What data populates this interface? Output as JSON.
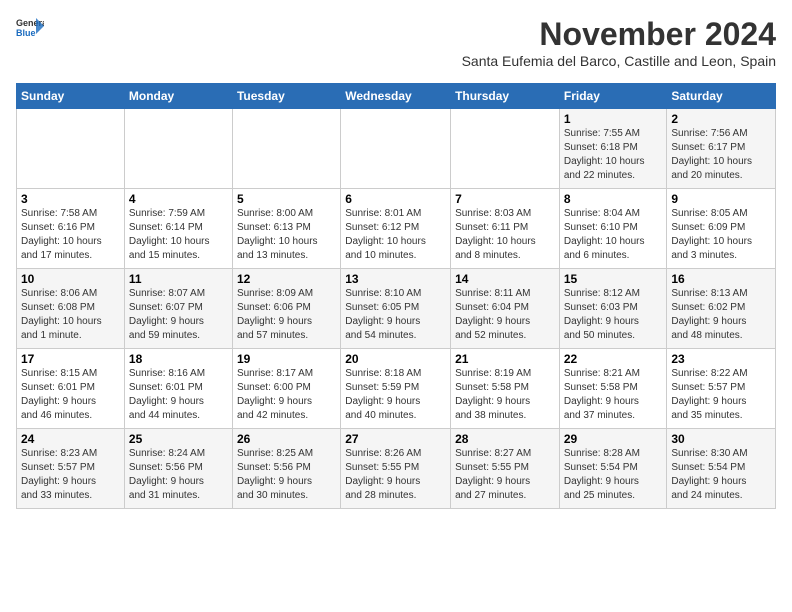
{
  "header": {
    "logo_line1": "General",
    "logo_line2": "Blue",
    "month_title": "November 2024",
    "subtitle": "Santa Eufemia del Barco, Castille and Leon, Spain"
  },
  "weekdays": [
    "Sunday",
    "Monday",
    "Tuesday",
    "Wednesday",
    "Thursday",
    "Friday",
    "Saturday"
  ],
  "weeks": [
    [
      {
        "day": "",
        "info": ""
      },
      {
        "day": "",
        "info": ""
      },
      {
        "day": "",
        "info": ""
      },
      {
        "day": "",
        "info": ""
      },
      {
        "day": "",
        "info": ""
      },
      {
        "day": "1",
        "info": "Sunrise: 7:55 AM\nSunset: 6:18 PM\nDaylight: 10 hours\nand 22 minutes."
      },
      {
        "day": "2",
        "info": "Sunrise: 7:56 AM\nSunset: 6:17 PM\nDaylight: 10 hours\nand 20 minutes."
      }
    ],
    [
      {
        "day": "3",
        "info": "Sunrise: 7:58 AM\nSunset: 6:16 PM\nDaylight: 10 hours\nand 17 minutes."
      },
      {
        "day": "4",
        "info": "Sunrise: 7:59 AM\nSunset: 6:14 PM\nDaylight: 10 hours\nand 15 minutes."
      },
      {
        "day": "5",
        "info": "Sunrise: 8:00 AM\nSunset: 6:13 PM\nDaylight: 10 hours\nand 13 minutes."
      },
      {
        "day": "6",
        "info": "Sunrise: 8:01 AM\nSunset: 6:12 PM\nDaylight: 10 hours\nand 10 minutes."
      },
      {
        "day": "7",
        "info": "Sunrise: 8:03 AM\nSunset: 6:11 PM\nDaylight: 10 hours\nand 8 minutes."
      },
      {
        "day": "8",
        "info": "Sunrise: 8:04 AM\nSunset: 6:10 PM\nDaylight: 10 hours\nand 6 minutes."
      },
      {
        "day": "9",
        "info": "Sunrise: 8:05 AM\nSunset: 6:09 PM\nDaylight: 10 hours\nand 3 minutes."
      }
    ],
    [
      {
        "day": "10",
        "info": "Sunrise: 8:06 AM\nSunset: 6:08 PM\nDaylight: 10 hours\nand 1 minute."
      },
      {
        "day": "11",
        "info": "Sunrise: 8:07 AM\nSunset: 6:07 PM\nDaylight: 9 hours\nand 59 minutes."
      },
      {
        "day": "12",
        "info": "Sunrise: 8:09 AM\nSunset: 6:06 PM\nDaylight: 9 hours\nand 57 minutes."
      },
      {
        "day": "13",
        "info": "Sunrise: 8:10 AM\nSunset: 6:05 PM\nDaylight: 9 hours\nand 54 minutes."
      },
      {
        "day": "14",
        "info": "Sunrise: 8:11 AM\nSunset: 6:04 PM\nDaylight: 9 hours\nand 52 minutes."
      },
      {
        "day": "15",
        "info": "Sunrise: 8:12 AM\nSunset: 6:03 PM\nDaylight: 9 hours\nand 50 minutes."
      },
      {
        "day": "16",
        "info": "Sunrise: 8:13 AM\nSunset: 6:02 PM\nDaylight: 9 hours\nand 48 minutes."
      }
    ],
    [
      {
        "day": "17",
        "info": "Sunrise: 8:15 AM\nSunset: 6:01 PM\nDaylight: 9 hours\nand 46 minutes."
      },
      {
        "day": "18",
        "info": "Sunrise: 8:16 AM\nSunset: 6:01 PM\nDaylight: 9 hours\nand 44 minutes."
      },
      {
        "day": "19",
        "info": "Sunrise: 8:17 AM\nSunset: 6:00 PM\nDaylight: 9 hours\nand 42 minutes."
      },
      {
        "day": "20",
        "info": "Sunrise: 8:18 AM\nSunset: 5:59 PM\nDaylight: 9 hours\nand 40 minutes."
      },
      {
        "day": "21",
        "info": "Sunrise: 8:19 AM\nSunset: 5:58 PM\nDaylight: 9 hours\nand 38 minutes."
      },
      {
        "day": "22",
        "info": "Sunrise: 8:21 AM\nSunset: 5:58 PM\nDaylight: 9 hours\nand 37 minutes."
      },
      {
        "day": "23",
        "info": "Sunrise: 8:22 AM\nSunset: 5:57 PM\nDaylight: 9 hours\nand 35 minutes."
      }
    ],
    [
      {
        "day": "24",
        "info": "Sunrise: 8:23 AM\nSunset: 5:57 PM\nDaylight: 9 hours\nand 33 minutes."
      },
      {
        "day": "25",
        "info": "Sunrise: 8:24 AM\nSunset: 5:56 PM\nDaylight: 9 hours\nand 31 minutes."
      },
      {
        "day": "26",
        "info": "Sunrise: 8:25 AM\nSunset: 5:56 PM\nDaylight: 9 hours\nand 30 minutes."
      },
      {
        "day": "27",
        "info": "Sunrise: 8:26 AM\nSunset: 5:55 PM\nDaylight: 9 hours\nand 28 minutes."
      },
      {
        "day": "28",
        "info": "Sunrise: 8:27 AM\nSunset: 5:55 PM\nDaylight: 9 hours\nand 27 minutes."
      },
      {
        "day": "29",
        "info": "Sunrise: 8:28 AM\nSunset: 5:54 PM\nDaylight: 9 hours\nand 25 minutes."
      },
      {
        "day": "30",
        "info": "Sunrise: 8:30 AM\nSunset: 5:54 PM\nDaylight: 9 hours\nand 24 minutes."
      }
    ]
  ]
}
